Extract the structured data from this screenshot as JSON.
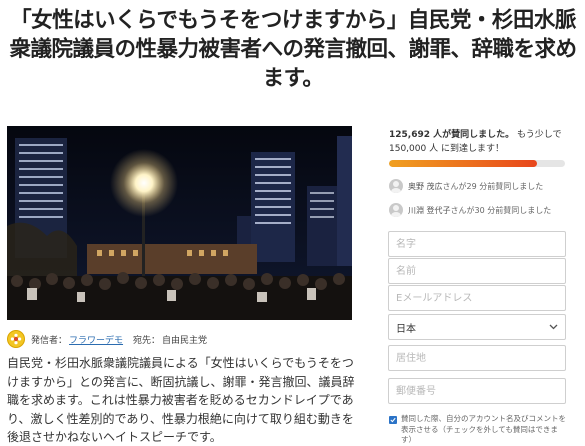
{
  "petition": {
    "title": "「女性はいくらでもうそをつけますから」自民党・杉田水脈衆議院議員の性暴力被害者への発言撤回、謝罪、辞職を求めます。",
    "starter_label": "発信者：",
    "starter_name": "フラワーデモ",
    "recipient_label": "宛先：",
    "recipient_name": "自由民主党",
    "description": "自民党・杉田水脈衆議院議員による「女性はいくらでもうそをつけますから」との発言に、断固抗議し、謝罪・発言撤回、議員辞職を求めます。これは性暴力被害者を貶めるセカンドレイプであり、激しく性差別的であり、性暴力根絶に向けて取り組む動きを後退させかねないヘイトスピーチです。"
  },
  "stats": {
    "signed_count": "125,692 人が賛同しました。",
    "goal_prefix": "もう少しで",
    "goal_count": "150,000 人",
    "goal_suffix": "に到達します！",
    "progress_fraction": 0.84,
    "progress_color": "#e8461c"
  },
  "recent_signers": [
    {
      "name": "奥野 茂広",
      "time": "さんが29 分前賛同しました"
    },
    {
      "name": "川淵 登代子",
      "time": "さんが30 分前賛同しました"
    }
  ],
  "form": {
    "last_name_placeholder": "名字",
    "first_name_placeholder": "名前",
    "email_placeholder": "Eメールアドレス",
    "country_value": "日本",
    "address_placeholder": "居住地",
    "postal_placeholder": "郵便番号",
    "consent_text": "賛同した際、自分のアカウント名及びコメントを表示させる（チェックを外しても賛同はできます）"
  },
  "colors": {
    "link": "#2b6cb0",
    "checkbox": "#2b73c7"
  }
}
